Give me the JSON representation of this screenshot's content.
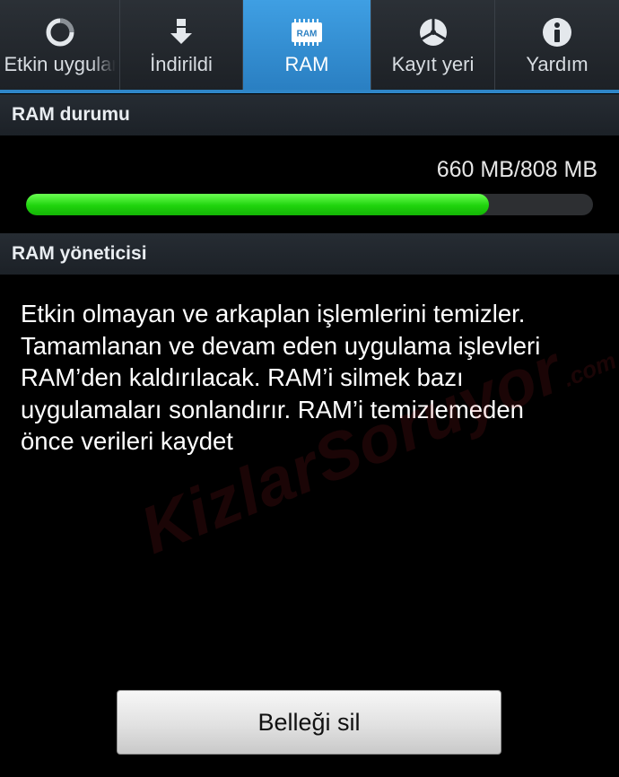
{
  "tabs": [
    {
      "label": "Etkin uygulamalar",
      "icon": "circle-progress-icon",
      "active": false
    },
    {
      "label": "İndirildi",
      "icon": "download-arrow-icon",
      "active": false
    },
    {
      "label": "RAM",
      "icon": "ram-chip-icon",
      "icon_text": "RAM",
      "active": true
    },
    {
      "label": "Kayıt yeri",
      "icon": "storage-pie-icon",
      "active": false
    },
    {
      "label": "Yardım",
      "icon": "info-icon",
      "active": false
    }
  ],
  "ram_status": {
    "header": "RAM durumu",
    "usage_text": "660 MB/808 MB",
    "used_mb": 660,
    "total_mb": 808,
    "used_fraction": 0.817
  },
  "ram_manager": {
    "header": "RAM yöneticisi",
    "description_lines": [
      "Etkin olmayan ve arkaplan işlemlerini temizler.",
      "Tamamlanan ve devam eden uygulama işlevleri",
      "RAM’den kaldırılacak. RAM’i silmek bazı",
      "uygulamaları sonlandırır. RAM’i temizlemeden",
      "önce verileri kaydet"
    ]
  },
  "clear_button_label": "Belleği sil",
  "watermark": {
    "main": "KizlarSoruyor",
    "suffix": ".com"
  },
  "colors": {
    "active_tab": "#2f86c8",
    "progress_fill": "#1fd30d",
    "progress_track": "#2d2f32",
    "header_bg": "#22272d"
  }
}
